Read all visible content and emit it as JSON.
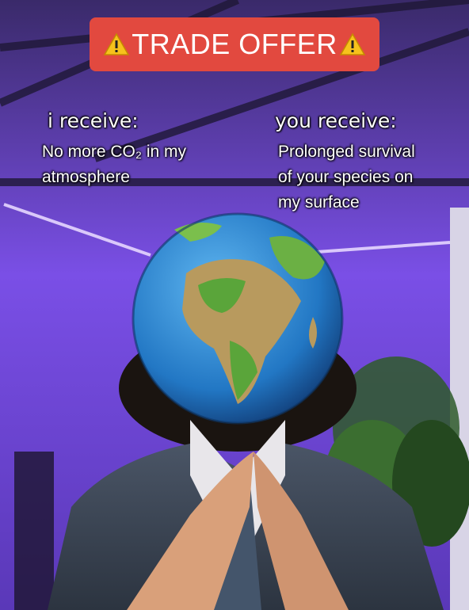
{
  "banner": {
    "text": "TRADE OFFER",
    "icon": "warning-icon"
  },
  "left": {
    "heading": "i receive:",
    "body_line1": "No more CO₂ in my",
    "body_line2": "atmosphere"
  },
  "right": {
    "heading": "you receive:",
    "body_line1": "Prolonged survival",
    "body_line2": "of your species on",
    "body_line3": "my surface"
  },
  "colors": {
    "banner": "#e2493f",
    "wall": "#6a3fd6",
    "suit": "#3f4a5c",
    "ocean": "#2e8fd8",
    "land": "#5aa53a"
  }
}
